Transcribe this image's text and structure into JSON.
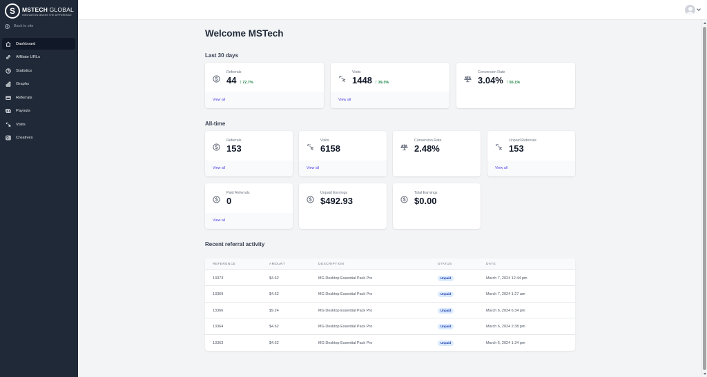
{
  "brand": {
    "name_bold": "MSTECH",
    "name_light": " GLOBAL",
    "tagline": "INNOVATION MAKES THE DIFFERENCE",
    "mark": "S"
  },
  "sidebar": {
    "back_label": "Back to site",
    "items": [
      {
        "label": "Dashboard",
        "icon": "home-icon",
        "active": true
      },
      {
        "label": "Affiliate URLs",
        "icon": "link-icon"
      },
      {
        "label": "Statistics",
        "icon": "pie-chart-icon"
      },
      {
        "label": "Graphs",
        "icon": "bar-chart-icon"
      },
      {
        "label": "Referrals",
        "icon": "credit-card-icon"
      },
      {
        "label": "Payouts",
        "icon": "cash-icon"
      },
      {
        "label": "Visits",
        "icon": "cursor-click-icon"
      },
      {
        "label": "Creatives",
        "icon": "photo-icon"
      }
    ]
  },
  "main": {
    "title": "Welcome MSTech",
    "last30": {
      "heading": "Last 30 days",
      "cards": [
        {
          "label": "Referrals",
          "value": "44",
          "change": "72.7%",
          "link": "View all",
          "icon": "currency-dollar-icon"
        },
        {
          "label": "Visits",
          "value": "1448",
          "change": "39.3%",
          "link": "View all",
          "icon": "cursor-click-icon"
        },
        {
          "label": "Conversion Rate",
          "value": "3.04%",
          "change": "55.1%",
          "icon": "scale-icon"
        }
      ]
    },
    "alltime": {
      "heading": "All-time",
      "cards": [
        {
          "label": "Referrals",
          "value": "153",
          "link": "View all",
          "icon": "currency-dollar-icon"
        },
        {
          "label": "Visits",
          "value": "6158",
          "link": "View all",
          "icon": "cursor-click-icon"
        },
        {
          "label": "Conversion Rate",
          "value": "2.48%",
          "icon": "scale-icon"
        },
        {
          "label": "Unpaid Referrals",
          "value": "153",
          "link": "View all",
          "icon": "cursor-click-icon"
        },
        {
          "label": "Paid Referrals",
          "value": "0",
          "link": "View all",
          "icon": "currency-dollar-icon"
        },
        {
          "label": "Unpaid Earnings",
          "value": "$492.93",
          "icon": "currency-dollar-icon"
        },
        {
          "label": "Total Earnings",
          "value": "$0.00",
          "icon": "currency-dollar-icon"
        }
      ]
    },
    "activity": {
      "heading": "Recent referral activity",
      "columns": [
        "REFERENCE",
        "AMOUNT",
        "DESCRIPTION",
        "STATUS",
        "DATE"
      ],
      "rows": [
        {
          "reference": "13373",
          "amount": "$4.62",
          "description": "MG Desktop Essential Pack Pro",
          "status": "Unpaid",
          "date": "March 7, 2024 12:44 pm"
        },
        {
          "reference": "13369",
          "amount": "$4.62",
          "description": "MG Desktop Essential Pack Pro",
          "status": "Unpaid",
          "date": "March 7, 2024 1:27 am"
        },
        {
          "reference": "13366",
          "amount": "$9.24",
          "description": "MG Desktop Essential Pack Pro",
          "status": "Unpaid",
          "date": "March 6, 2024 6:34 pm"
        },
        {
          "reference": "13364",
          "amount": "$4.62",
          "description": "MG Desktop Essential Pack Pro",
          "status": "Unpaid",
          "date": "March 6, 2024 2:38 pm"
        },
        {
          "reference": "13363",
          "amount": "$4.62",
          "description": "MG Desktop Essential Pack Pro",
          "status": "Unpaid",
          "date": "March 6, 2024 1:34 pm"
        }
      ]
    }
  }
}
